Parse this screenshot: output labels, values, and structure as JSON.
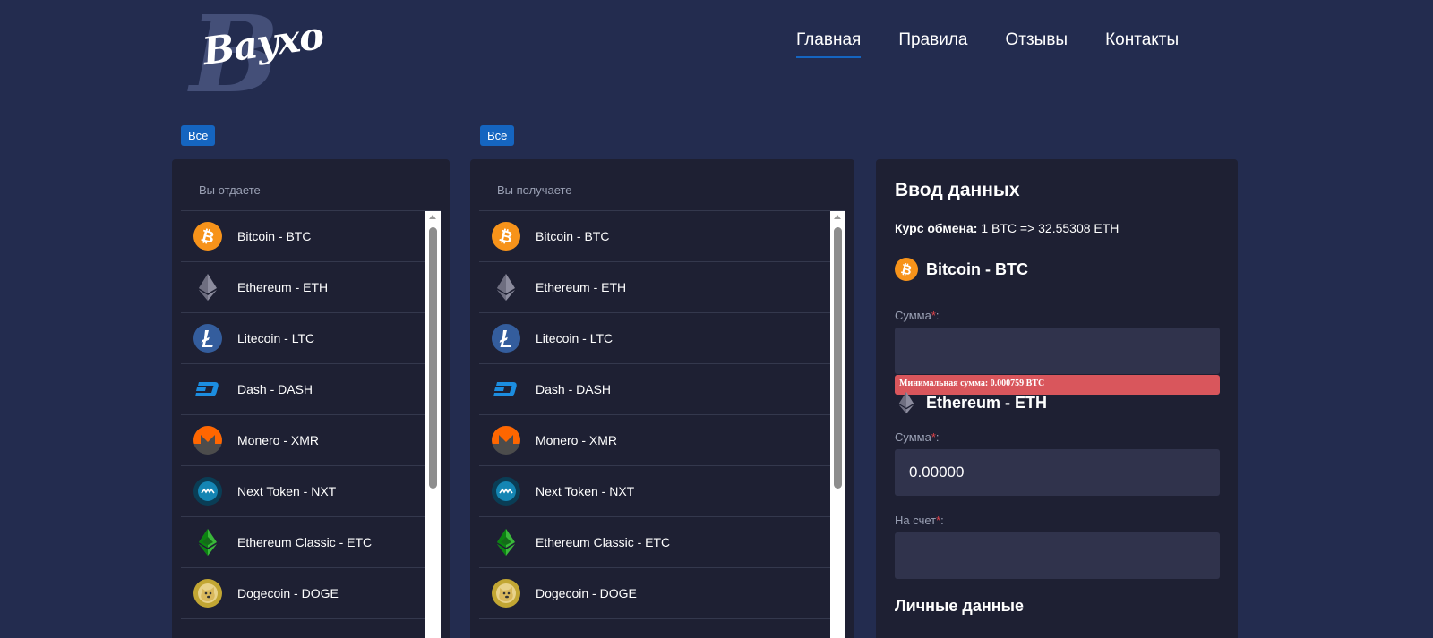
{
  "header": {
    "logo_text": "Bayxo",
    "logo_letter": "B",
    "nav": [
      {
        "label": "Главная",
        "active": true
      },
      {
        "label": "Правила",
        "active": false
      },
      {
        "label": "Отзывы",
        "active": false
      },
      {
        "label": "Контакты",
        "active": false
      }
    ]
  },
  "give_panel": {
    "filter_label": "Все",
    "title": "Вы отдаете"
  },
  "get_panel": {
    "filter_label": "Все",
    "title": "Вы получаете"
  },
  "currencies": [
    {
      "label": "Bitcoin - BTC",
      "icon": "bitcoin-icon"
    },
    {
      "label": "Ethereum - ETH",
      "icon": "ethereum-icon"
    },
    {
      "label": "Litecoin - LTC",
      "icon": "litecoin-icon"
    },
    {
      "label": "Dash - DASH",
      "icon": "dash-icon"
    },
    {
      "label": "Monero - XMR",
      "icon": "monero-icon"
    },
    {
      "label": "Next Token - NXT",
      "icon": "nxt-icon"
    },
    {
      "label": "Ethereum Classic - ETC",
      "icon": "ethereum-classic-icon"
    },
    {
      "label": "Dogecoin - DOGE",
      "icon": "dogecoin-icon"
    }
  ],
  "form": {
    "title": "Ввод данных",
    "rate_label": "Курс обмена:",
    "rate_value": "1 BTC => 32.55308 ETH",
    "give_currency": "Bitcoin - BTC",
    "give_amount_label": "Сумма",
    "give_amount_value": "",
    "min_amount_error": "Минимальная сумма: 0.000759 BTC",
    "get_currency": "Ethereum - ETH",
    "get_amount_label": "Сумма",
    "get_amount_value": "0.00000",
    "account_label": "На счет",
    "account_value": "",
    "required_mark": "*",
    "label_colon": ":",
    "personal_section": "Личные данные"
  },
  "colors": {
    "background": "#232c4f",
    "panel": "#1e2033",
    "accent": "#1565c0",
    "error": "#d9565c",
    "input": "#30334c"
  }
}
